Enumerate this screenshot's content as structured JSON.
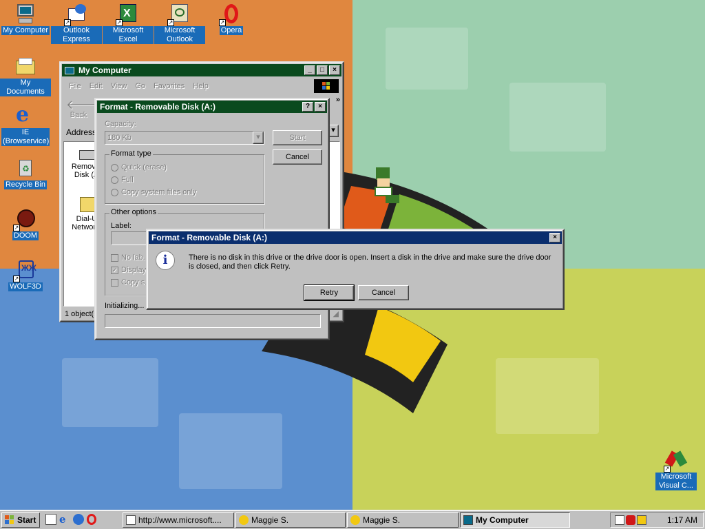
{
  "desktop_icons": [
    {
      "name": "my-computer",
      "label": "My Computer",
      "icon": "computer-icon"
    },
    {
      "name": "outlook-express",
      "label": "Outlook Express",
      "icon": "outlook-express-icon"
    },
    {
      "name": "microsoft-excel",
      "label": "Microsoft Excel",
      "icon": "excel-icon"
    },
    {
      "name": "microsoft-outlook",
      "label": "Microsoft Outlook",
      "icon": "outlook-icon"
    },
    {
      "name": "opera",
      "label": "Opera",
      "icon": "opera-icon"
    },
    {
      "name": "my-documents",
      "label": "My Documents",
      "icon": "folder-icon"
    },
    {
      "name": "ie-browservice",
      "label": "IE (Browservice)",
      "icon": "internet-explorer-icon"
    },
    {
      "name": "recycle-bin",
      "label": "Recycle Bin",
      "icon": "recycle-bin-icon"
    },
    {
      "name": "doom",
      "label": "DOOM",
      "icon": "doom-icon"
    },
    {
      "name": "wolf3d",
      "label": "WOLF3D",
      "icon": "wolf3d-icon"
    },
    {
      "name": "visual-c",
      "label": "Microsoft Visual C...",
      "icon": "visual-c-icon"
    }
  ],
  "explorer": {
    "title": "My Computer",
    "menu": [
      "File",
      "Edit",
      "View",
      "Go",
      "Favorites",
      "Help"
    ],
    "back_label": "Back",
    "address_label": "Address",
    "items": [
      {
        "label": "Remova... Disk (A:)",
        "icon": "floppy-drive-icon"
      },
      {
        "label": "Dial-Up Network...",
        "icon": "dialup-folder-icon"
      }
    ],
    "status": "1 object(s..."
  },
  "format_dialog": {
    "title": "Format - Removable Disk (A:)",
    "capacity_label": "Capacity:",
    "capacity_value": "180 Kb",
    "start_label": "Start",
    "cancel_label": "Cancel",
    "format_type_label": "Format type",
    "format_options": [
      "Quick (erase)",
      "Full",
      "Copy system files only"
    ],
    "other_options_label": "Other options",
    "label_label": "Label:",
    "checkboxes": [
      "No lab...",
      "Display...",
      "Copy s..."
    ],
    "status": "Initializing..."
  },
  "error_dialog": {
    "title": "Format - Removable Disk (A:)",
    "message": "There is no disk in this drive or the drive door is open.  Insert a disk in the drive and make sure the drive door is closed, and then click Retry.",
    "retry_label": "Retry",
    "cancel_label": "Cancel"
  },
  "taskbar": {
    "start_label": "Start",
    "tasks": [
      {
        "label": "http://www.microsoft....",
        "icon": "ie-page-icon",
        "active": false
      },
      {
        "label": "Maggie S.",
        "icon": "maggie-icon",
        "active": false
      },
      {
        "label": "Maggie S.",
        "icon": "maggie-icon",
        "active": false
      },
      {
        "label": "My Computer",
        "icon": "computer-icon",
        "active": true
      }
    ],
    "clock": "1:17 AM"
  }
}
